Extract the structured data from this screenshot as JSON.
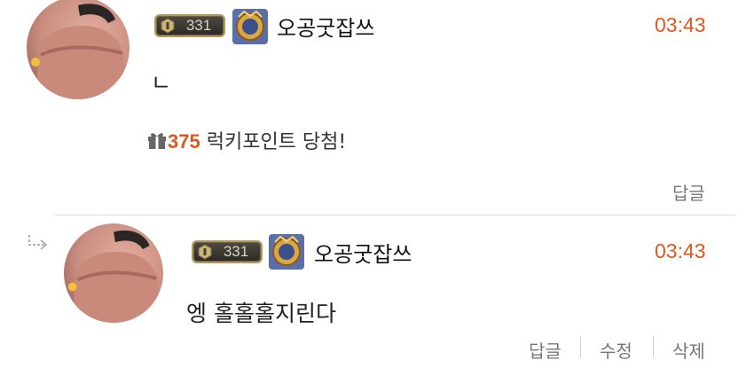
{
  "comments": [
    {
      "author": {
        "level": "331",
        "nickname": "오공굿잡쓰",
        "avatar_icon": "avatar-image",
        "rank_icon": "rank-emblem-icon"
      },
      "time": "03:43",
      "text": "ㄴ",
      "lucky": {
        "icon": "gift-icon",
        "points": "375",
        "label": "럭키포인트 당첨!"
      },
      "actions": {
        "reply": "답글"
      }
    },
    {
      "is_reply": true,
      "reply_icon": "reply-arrow-icon",
      "author": {
        "level": "331",
        "nickname": "오공굿잡쓰",
        "avatar_icon": "avatar-image",
        "rank_icon": "rank-emblem-icon"
      },
      "time": "03:43",
      "text": "엥 홀홀홀지린다",
      "actions": {
        "reply": "답글",
        "edit": "수정",
        "delete": "삭제"
      }
    }
  ],
  "colors": {
    "accent": "#e0581c",
    "text": "#222222",
    "muted": "#777777",
    "divider": "#dddddd"
  }
}
